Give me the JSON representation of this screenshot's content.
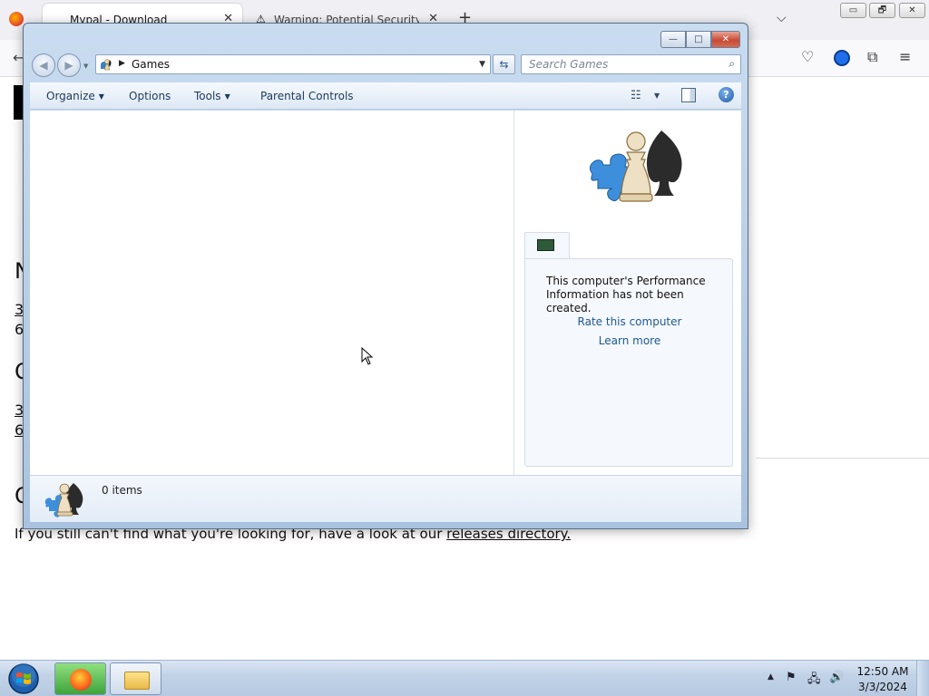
{
  "browser": {
    "tabs": [
      {
        "title": "Mypal - Download",
        "close": "✕"
      },
      {
        "title": "Warning: Potential Security Risk",
        "close": "✕",
        "warning_icon": "⚠"
      }
    ],
    "new_tab": "+",
    "list_tabs": "⌵",
    "window_controls": {
      "minimize": "▭",
      "restore": "🗗",
      "close": "✕"
    },
    "toolbar_icons": {
      "back": "⟵",
      "pocket": "♡",
      "extensions": "⧉",
      "menu": "≡"
    },
    "page": {
      "heading_1": "N",
      "heading_2": "O",
      "heading_3": "O",
      "link_1": "3",
      "text_1": "6",
      "link_2": "3",
      "link_3": "6",
      "footer_text": "If you still can't find what you're looking for, have a look at our ",
      "footer_link": "releases directory."
    }
  },
  "games_window": {
    "caption_buttons": {
      "minimize": "—",
      "maximize": "□",
      "close": "✕"
    },
    "nav": {
      "back": "◀",
      "forward": "▶",
      "recent": "▼"
    },
    "address": {
      "crumb_arrow": "▶",
      "location": "Games",
      "dropdown": "▼"
    },
    "refresh": "⇆",
    "search": {
      "placeholder": "Search Games",
      "icon": "⌕"
    },
    "command_bar": {
      "organize": "Organize",
      "options": "Options",
      "tools": "Tools",
      "parental_controls": "Parental Controls",
      "caret": "▼",
      "view_icon": "☷",
      "help": "?"
    },
    "preview_pane": {
      "message": "This computer's Performance Information has not been created.",
      "rate_link": "Rate this computer",
      "learn_more": "Learn more"
    },
    "details": {
      "item_count": "0 items"
    }
  },
  "taskbar": {
    "tray": {
      "show_hidden": "▲",
      "flag": "⚑",
      "network": "🖧",
      "volume": "🔊"
    },
    "clock": {
      "time": "12:50 AM",
      "date": "3/3/2024"
    }
  },
  "colors": {
    "aero_frame": "#b6cde6",
    "link_blue": "#1c5a94",
    "close_red": "#c74a34",
    "taskbar": "#c2d3e8"
  }
}
